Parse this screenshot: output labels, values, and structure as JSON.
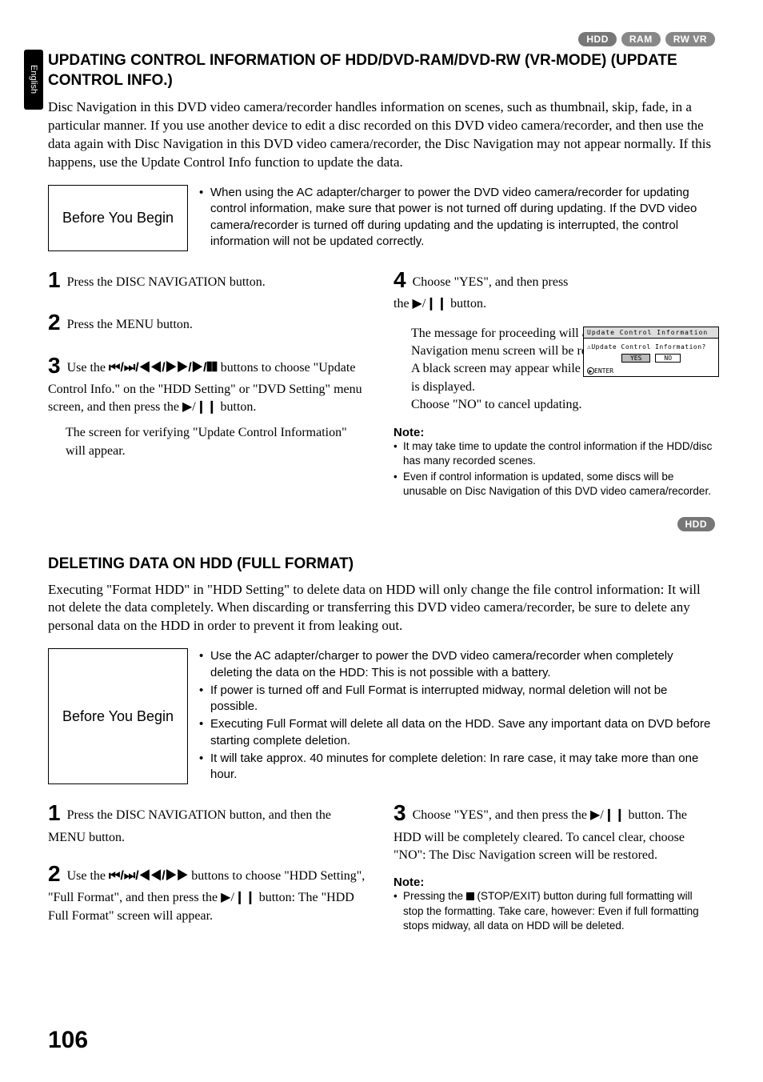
{
  "lang_tab": "English",
  "top_badges": [
    "HDD",
    "RAM",
    "RW VR"
  ],
  "section1": {
    "title": "UPDATING CONTROL INFORMATION OF HDD/DVD-RAM/DVD-RW (VR-MODE) (UPDATE CONTROL INFO.)",
    "intro": "Disc Navigation in this DVD video camera/recorder handles information on scenes, such as thumbnail, skip, fade, in a particular manner. If you use another device to edit a disc recorded on this DVD video camera/recorder, and then use the data again with Disc Navigation in this DVD video camera/recorder, the Disc Navigation may not appear normally. If this happens, use the Update Control Info function to update the data.",
    "before_label": "Before You Begin",
    "before_bullets": [
      "When using the AC adapter/charger to power the DVD video camera/recorder for updating control information, make sure that power is not turned off during updating. If the DVD video camera/recorder is turned off during updating and the updating is interrupted, the control information will not be updated correctly."
    ],
    "steps_left": [
      {
        "n": "1",
        "text": "Press the DISC NAVIGATION button."
      },
      {
        "n": "2",
        "text": "Press the MENU button."
      },
      {
        "n": "3",
        "text_pre": "Use the ",
        "icons": "◂◂ /▸▸ /◂◂ /▸▸ /▶/❙❙",
        "text_post": " buttons to choose \"Update Control Info.\" on the \"HDD Setting\" or \"DVD Setting\" menu screen, and then press the ▶/❙❙ button.",
        "trail": "The screen for verifying \"Update Control Information\" will appear."
      }
    ],
    "steps_right": [
      {
        "n": "4",
        "text": "Choose \"YES\", and then press the ▶/❙❙ button.",
        "trail1": "The message for proceeding will appear, and then the Disc Navigation menu screen will be restored.",
        "trail2": "A black screen may appear while the message for updating is displayed.",
        "trail3": "Choose \"NO\" to cancel updating."
      }
    ],
    "note_label": "Note:",
    "notes": [
      "It may take time to update the control information if the HDD/disc has many recorded scenes.",
      "Even if control information is updated, some discs will be unusable on Disc Navigation of this DVD video camera/recorder."
    ]
  },
  "dialog": {
    "header": "Update Control Information",
    "question": "Update Control Information?",
    "yes": "YES",
    "no": "NO",
    "enter": "ENTER"
  },
  "mid_badge": "HDD",
  "section2": {
    "title": "DELETING DATA ON HDD (FULL FORMAT)",
    "intro": "Executing \"Format HDD\" in \"HDD Setting\" to delete data on HDD will only change the file control information: It will not delete the data completely. When discarding or transferring this DVD video camera/recorder, be sure to delete any personal data on the HDD in order to prevent it from leaking out.",
    "before_label": "Before You Begin",
    "before_bullets": [
      "Use the AC adapter/charger to power the DVD video camera/recorder when completely deleting the data on the HDD: This is not possible with a battery.",
      "If power is turned off and Full Format is interrupted midway, normal deletion will not be possible.",
      "Executing Full Format will delete all data on the HDD. Save any important data on DVD before starting complete deletion.",
      "It will take approx. 40 minutes for complete deletion: In rare case, it may take more than one hour."
    ],
    "steps_left": [
      {
        "n": "1",
        "text": "Press the DISC NAVIGATION button, and then the MENU button."
      },
      {
        "n": "2",
        "text_pre": "Use the ",
        "icons": "◂◂ /▸▸ /◂◂ /▸▸",
        "text_post": " buttons to choose \"HDD Setting\", \"Full Format\", and then press the ▶/❙❙ button: The \"HDD Full Format\" screen will appear."
      }
    ],
    "steps_right": [
      {
        "n": "3",
        "text": "Choose \"YES\", and then press the ▶/❙❙ button. The HDD will be completely cleared. To cancel clear, choose \"NO\": The Disc Navigation screen will be restored."
      }
    ],
    "note_label": "Note:",
    "notes": [
      "Pressing the ■ (STOP/EXIT) button during full formatting will stop the formatting. Take care, however: Even if full formatting stops midway, all data on HDD will be deleted."
    ]
  },
  "page_number": "106"
}
